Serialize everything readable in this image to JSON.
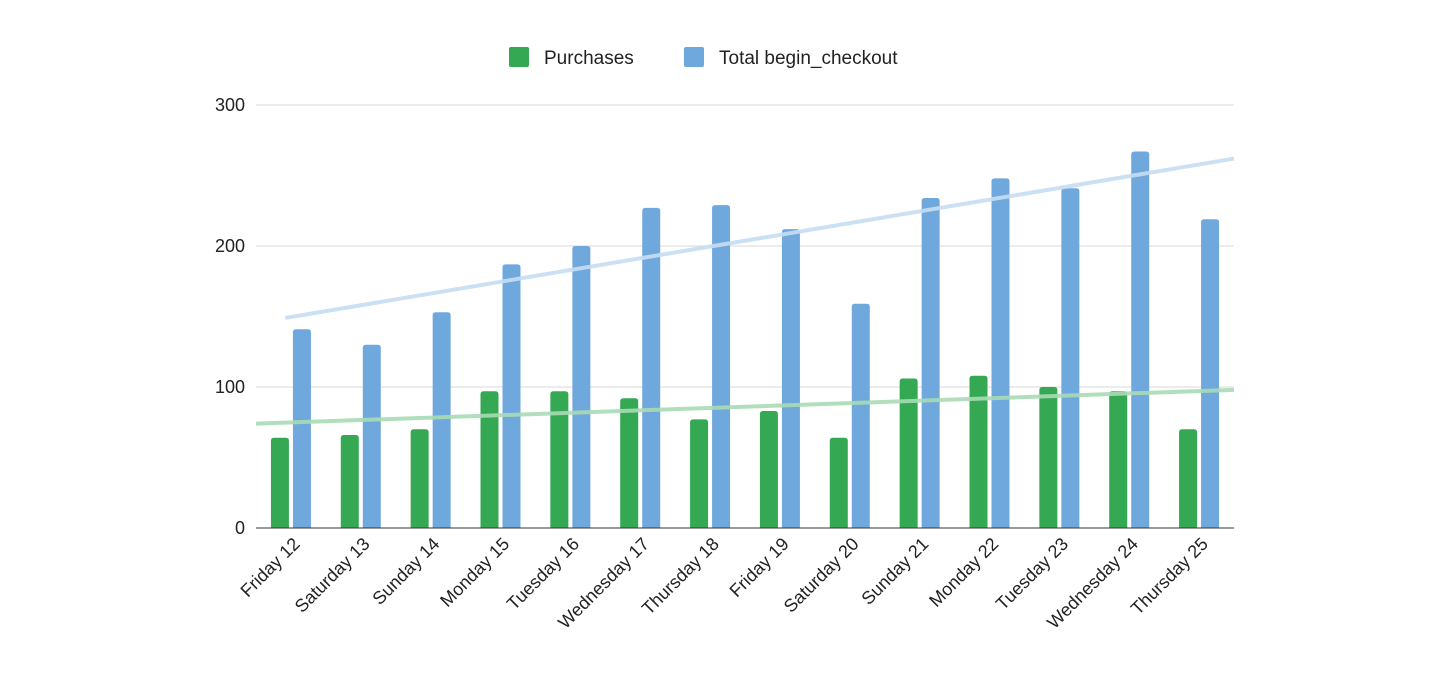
{
  "chart_data": {
    "type": "bar",
    "title": "",
    "xlabel": "",
    "ylabel": "",
    "ylim": [
      0,
      300
    ],
    "yticks": [
      0,
      100,
      200,
      300
    ],
    "grid": true,
    "legend_position": "top",
    "categories": [
      "Friday 12",
      "Saturday 13",
      "Sunday 14",
      "Monday 15",
      "Tuesday 16",
      "Wednesday 17",
      "Thursday 18",
      "Friday 19",
      "Saturday 20",
      "Sunday 21",
      "Monday 22",
      "Tuesday 23",
      "Wednesday 24",
      "Thursday 25"
    ],
    "series": [
      {
        "name": "Purchases",
        "color": "#34a853",
        "trend_color": "#a8dab5",
        "values": [
          64,
          66,
          70,
          97,
          97,
          92,
          77,
          83,
          64,
          106,
          108,
          100,
          97,
          70
        ],
        "trendline": {
          "start": 74,
          "end": 98
        }
      },
      {
        "name": "Total begin_checkout",
        "color": "#6fa8dc",
        "trend_color": "#c5ddf2",
        "values": [
          141,
          130,
          153,
          187,
          200,
          227,
          229,
          212,
          159,
          234,
          248,
          241,
          267,
          219
        ],
        "trendline": {
          "start": 149,
          "end": 262
        }
      }
    ]
  }
}
